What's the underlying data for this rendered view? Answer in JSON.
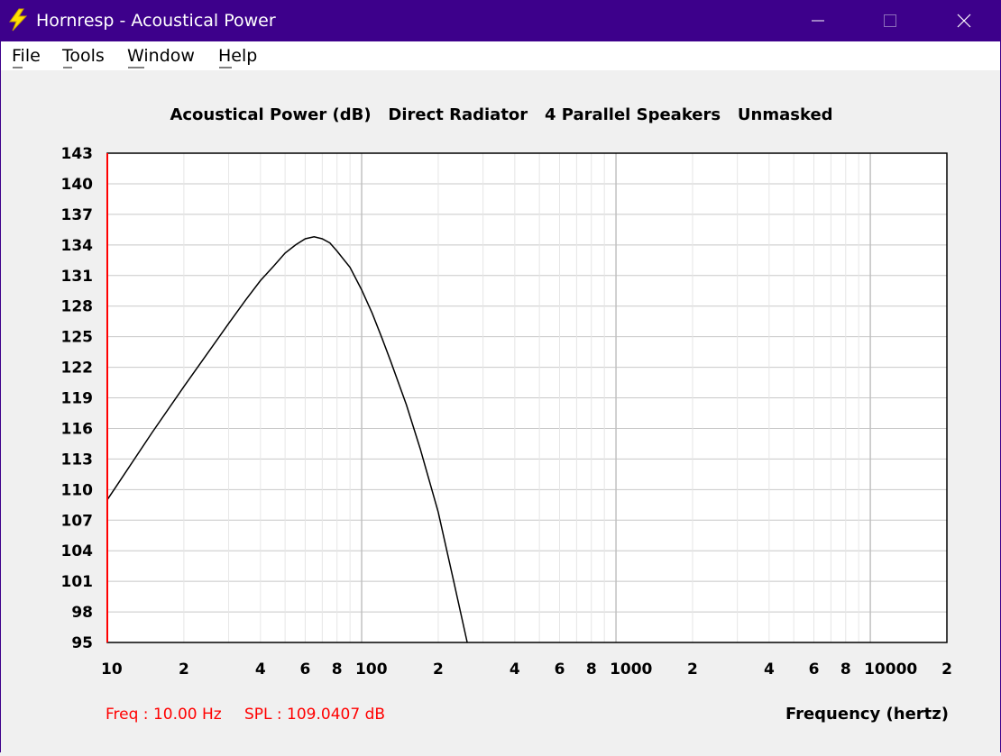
{
  "window": {
    "title": "Hornresp - Acoustical Power",
    "accent": "#3d008b",
    "icon": "lightning-bolt-icon"
  },
  "menu": {
    "items": [
      {
        "label": "File",
        "name": "file"
      },
      {
        "label": "Tools",
        "name": "tools"
      },
      {
        "label": "Window",
        "name": "window"
      },
      {
        "label": "Help",
        "name": "help"
      }
    ]
  },
  "chart_data": {
    "type": "line",
    "title": "Acoustical Power (dB)   Direct Radiator   4 Parallel Speakers   Unmasked",
    "xlabel": "Frequency (hertz)",
    "ylabel": "",
    "x_scale": "log",
    "xlim": [
      10,
      20000
    ],
    "ylim": [
      95,
      143
    ],
    "grid": true,
    "y_ticks": [
      143,
      140,
      137,
      134,
      131,
      128,
      125,
      122,
      119,
      116,
      113,
      110,
      107,
      104,
      101,
      98,
      95
    ],
    "x_ticks": [
      {
        "value": 10,
        "label": "10"
      },
      {
        "value": 20,
        "label": "2"
      },
      {
        "value": 40,
        "label": "4"
      },
      {
        "value": 60,
        "label": "6"
      },
      {
        "value": 80,
        "label": "8"
      },
      {
        "value": 100,
        "label": "100"
      },
      {
        "value": 200,
        "label": "2"
      },
      {
        "value": 400,
        "label": "4"
      },
      {
        "value": 600,
        "label": "6"
      },
      {
        "value": 800,
        "label": "8"
      },
      {
        "value": 1000,
        "label": "1000"
      },
      {
        "value": 2000,
        "label": "2"
      },
      {
        "value": 4000,
        "label": "4"
      },
      {
        "value": 6000,
        "label": "6"
      },
      {
        "value": 8000,
        "label": "8"
      },
      {
        "value": 10000,
        "label": "10000"
      },
      {
        "value": 20000,
        "label": "2"
      }
    ],
    "series": [
      {
        "color": "#000000",
        "x": [
          10,
          15,
          20,
          25,
          30,
          35,
          40,
          45,
          50,
          55,
          60,
          65,
          70,
          75,
          80,
          90,
          100,
          110,
          120,
          130,
          150,
          170,
          200,
          230,
          260
        ],
        "y": [
          109.0,
          115.6,
          120.1,
          123.5,
          126.3,
          128.6,
          130.5,
          131.9,
          133.2,
          134.0,
          134.6,
          134.8,
          134.6,
          134.2,
          133.4,
          131.8,
          129.6,
          127.3,
          124.9,
          122.6,
          118.3,
          114.0,
          107.8,
          101.0,
          95.0
        ]
      }
    ],
    "cursor": {
      "color": "#ff0000",
      "x": 10
    }
  },
  "status": {
    "freq": "Freq : 10.00 Hz",
    "spl": "SPL : 109.0407 dB",
    "color": "#ff0000"
  }
}
